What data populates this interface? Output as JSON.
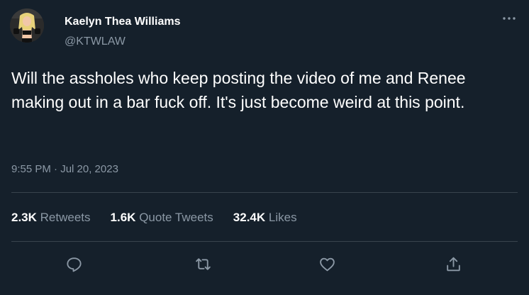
{
  "tweet": {
    "author_name": "Kaelyn Thea Williams",
    "author_handle": "@KTWLAW",
    "text": "Will the assholes who keep posting the video of me and Renee making out in a bar fuck off. It's just become weird at this point.",
    "timestamp": "9:55 PM · Jul 20, 2023"
  },
  "stats": {
    "retweets_count": "2.3K",
    "retweets_label": "Retweets",
    "quotes_count": "1.6K",
    "quotes_label": "Quote Tweets",
    "likes_count": "32.4K",
    "likes_label": "Likes"
  },
  "icons": {
    "more": "more-horizontal-icon",
    "reply": "reply-icon",
    "retweet": "retweet-icon",
    "like": "heart-icon",
    "share": "share-icon"
  },
  "colors": {
    "background": "#15202b",
    "primary_text": "#ffffff",
    "secondary_text": "#8b98a5",
    "divider": "#38444d"
  }
}
